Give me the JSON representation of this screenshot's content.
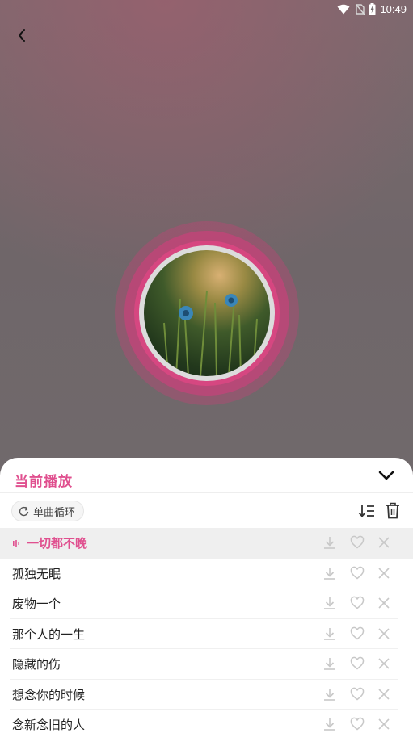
{
  "status_bar": {
    "time": "10:49"
  },
  "sheet": {
    "title": "当前播放",
    "play_mode": "单曲循环"
  },
  "playlist": [
    {
      "title": "一切都不晚",
      "active": true
    },
    {
      "title": "孤独无眠",
      "active": false
    },
    {
      "title": "废物一个",
      "active": false
    },
    {
      "title": "那个人的一生",
      "active": false
    },
    {
      "title": "隐藏的伤",
      "active": false
    },
    {
      "title": "想念你的时候",
      "active": false
    },
    {
      "title": "念新念旧的人",
      "active": false
    }
  ],
  "colors": {
    "accent": "#e0508f",
    "ring": "#d83c7a"
  },
  "icons": {
    "back": "back-arrow-icon",
    "collapse": "chevron-down-icon",
    "play_mode": "repeat-one-icon",
    "sort": "sort-list-icon",
    "delete": "trash-icon",
    "download": "download-icon",
    "favorite": "heart-icon",
    "remove": "close-icon"
  }
}
